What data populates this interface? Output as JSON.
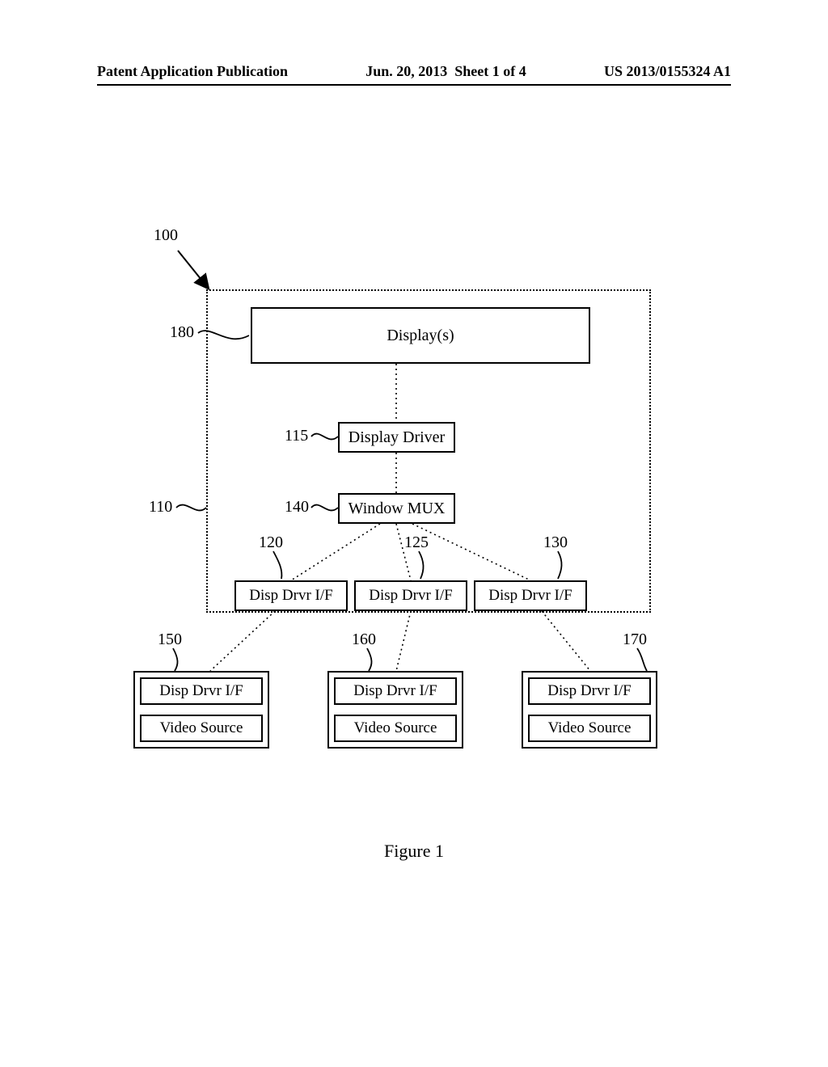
{
  "header": {
    "pub": "Patent Application Publication",
    "date": "Jun. 20, 2013",
    "sheet": "Sheet 1 of 4",
    "docnum": "US 2013/0155324 A1"
  },
  "refs": {
    "r100": "100",
    "r180": "180",
    "r115": "115",
    "r110": "110",
    "r140": "140",
    "r120": "120",
    "r125": "125",
    "r130": "130",
    "r150": "150",
    "r160": "160",
    "r170": "170"
  },
  "boxes": {
    "displays": "Display(s)",
    "display_driver": "Display Driver",
    "window_mux": "Window MUX",
    "disp_drvr_if": "Disp Drvr I/F",
    "video_source": "Video Source"
  },
  "caption": "Figure 1"
}
